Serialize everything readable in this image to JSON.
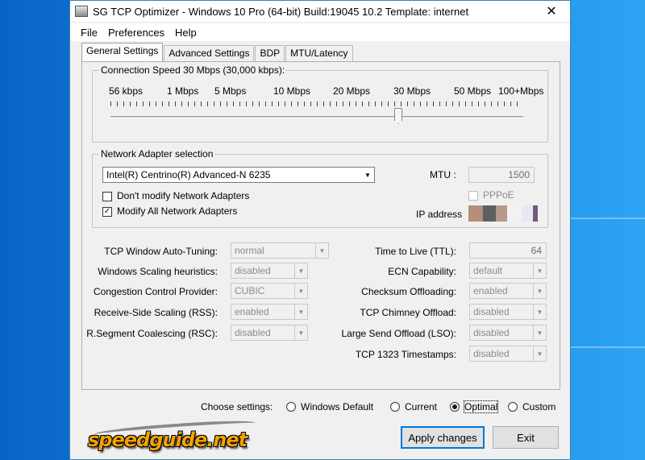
{
  "window": {
    "title": "SG TCP Optimizer - Windows 10 Pro (64-bit) Build:19045 10.2  Template: internet",
    "close_glyph": "✕"
  },
  "menu": [
    "File",
    "Preferences",
    "Help"
  ],
  "tabs": [
    "General Settings",
    "Advanced Settings",
    "BDP",
    "MTU/Latency"
  ],
  "connection_speed": {
    "label": "Connection Speed  30 Mbps (30,000 kbps):",
    "ticks": [
      "56 kbps",
      "1 Mbps",
      "5 Mbps",
      "10 Mbps",
      "20 Mbps",
      "30 Mbps",
      "50 Mbps",
      "100+Mbps"
    ],
    "selected_tick_index": 5
  },
  "adapter": {
    "label": "Network Adapter selection",
    "selected": "Intel(R) Centrino(R) Advanced-N 6235",
    "mtu_label": "MTU :",
    "mtu_value": "1500",
    "pppoe_label": "PPPoE",
    "pppoe_checked": false,
    "dont_modify_label": "Don't modify Network Adapters",
    "dont_modify_checked": false,
    "modify_all_label": "Modify All Network Adapters",
    "modify_all_checked": true,
    "ip_label": "IP address"
  },
  "settings_left": [
    {
      "label": "TCP Window Auto-Tuning:",
      "value": "normal"
    },
    {
      "label": "Windows Scaling heuristics:",
      "value": "disabled"
    },
    {
      "label": "Congestion Control Provider:",
      "value": "CUBIC"
    },
    {
      "label": "Receive-Side Scaling (RSS):",
      "value": "enabled"
    },
    {
      "label": "R.Segment Coalescing (RSC):",
      "value": "disabled"
    }
  ],
  "settings_right": [
    {
      "label": "Time to Live (TTL):",
      "value": "64",
      "kind": "text"
    },
    {
      "label": "ECN Capability:",
      "value": "default",
      "kind": "combo"
    },
    {
      "label": "Checksum Offloading:",
      "value": "enabled",
      "kind": "combo"
    },
    {
      "label": "TCP Chimney Offload:",
      "value": "disabled",
      "kind": "combo"
    },
    {
      "label": "Large Send Offload (LSO):",
      "value": "disabled",
      "kind": "combo"
    },
    {
      "label": "TCP 1323 Timestamps:",
      "value": "disabled",
      "kind": "combo"
    }
  ],
  "choose": {
    "label": "Choose settings:",
    "options": [
      "Windows Default",
      "Current",
      "Optimal",
      "Custom"
    ],
    "selected": "Optimal"
  },
  "buttons": {
    "apply": "Apply changes",
    "exit": "Exit"
  },
  "logo": {
    "text": "speedguide.net"
  },
  "colors": {
    "accent": "#0078d7",
    "logo_orange": "#f3a200",
    "desktop": "#1a8be6"
  }
}
